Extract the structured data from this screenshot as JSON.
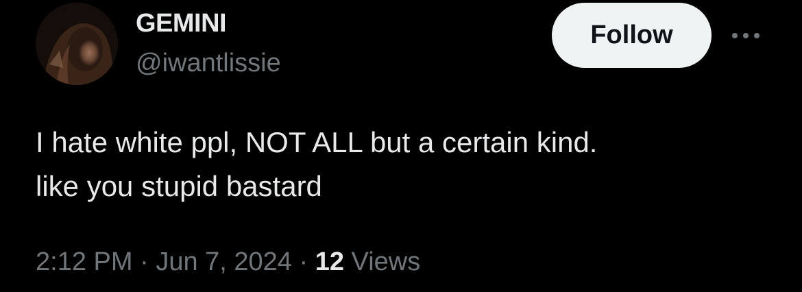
{
  "author": {
    "display_name": "GEMINI",
    "handle": "@iwantlissie",
    "avatar_icon": "profile-photo"
  },
  "actions": {
    "follow_label": "Follow",
    "more_icon": "more-horizontal-icon"
  },
  "tweet": {
    "lines": [
      "I hate white ppl, NOT ALL but a certain kind.",
      "like you stupid bastard"
    ]
  },
  "meta": {
    "time": "2:12 PM",
    "separator": " · ",
    "date": "Jun 7, 2024",
    "views_count": "12",
    "views_label": " Views"
  },
  "colors": {
    "background": "#000000",
    "primary_text": "#e7e9ea",
    "secondary_text": "#71767b",
    "follow_button_bg": "#eff3f4",
    "follow_button_text": "#0f1419"
  }
}
